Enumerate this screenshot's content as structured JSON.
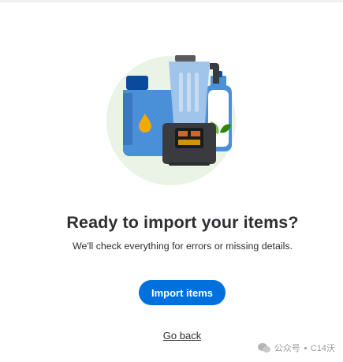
{
  "illustration": {
    "icon": "blender-and-bottles-icon",
    "colors": {
      "circle": "#eaf3e6",
      "jug": "#4a90d9",
      "drop": "#f2a900",
      "blender_body": "#3a3b3e",
      "bottle": "#ffffff",
      "leaf": "#76c043"
    }
  },
  "main": {
    "title": "Ready to import your items?",
    "subtitle": "We'll check everything for errors or missing details.",
    "import_button": "Import items",
    "back_link": "Go back"
  },
  "watermark": {
    "channel": "公众号",
    "name": "C14沃"
  },
  "colors": {
    "primary": "#0071dc",
    "text": "#2e2f32"
  }
}
